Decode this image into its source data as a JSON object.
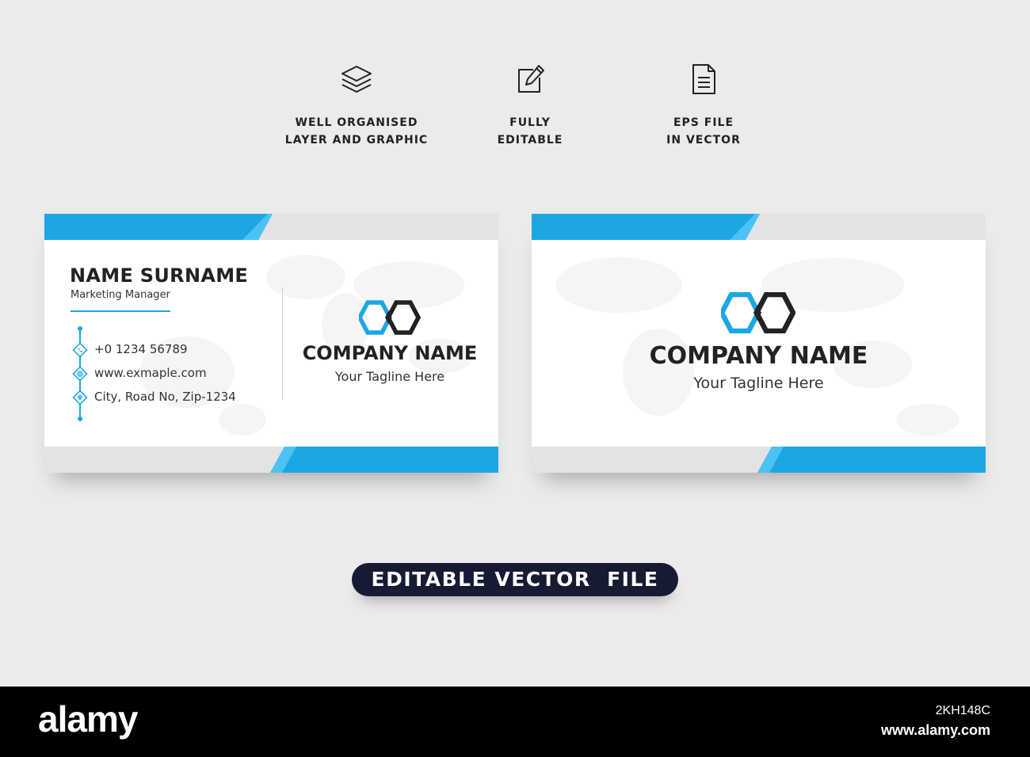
{
  "features": [
    {
      "icon": "layers-icon",
      "line1": "WELL ORGANISED",
      "line2": "LAYER AND GRAPHIC"
    },
    {
      "icon": "edit-icon",
      "line1": "FULLY",
      "line2": "EDITABLE"
    },
    {
      "icon": "document-icon",
      "line1": "EPS FILE",
      "line2": "IN VECTOR"
    }
  ],
  "front_card": {
    "name": "NAME SURNAME",
    "role": "Marketing Manager",
    "phone": "+0 1234 56789",
    "website": "www.exmaple.com",
    "address": "City, Road No, Zip-1234",
    "company": "COMPANY NAME",
    "tagline": "Your Tagline Here"
  },
  "back_card": {
    "company": "COMPANY NAME",
    "tagline": "Your Tagline Here"
  },
  "banner": "EDITABLE VECTOR  FILE",
  "footer": {
    "brand": "alamy",
    "image_code": "2KH148C",
    "site": "www.alamy.com"
  },
  "colors": {
    "accent_blue": "#1da6e4",
    "dark": "#222222",
    "pill": "#161a33",
    "gray_band": "#e3e3e3"
  }
}
